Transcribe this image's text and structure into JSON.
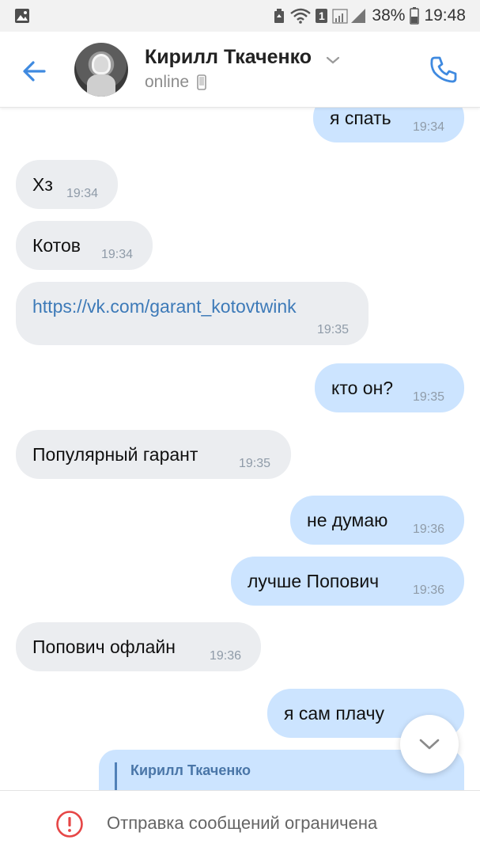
{
  "status_bar": {
    "battery": "38%",
    "time": "19:48",
    "sim_badge": "1"
  },
  "header": {
    "contact_name": "Кирилл Ткаченко",
    "status": "online"
  },
  "messages": [
    {
      "dir": "out",
      "text": "я спать",
      "time": "19:34"
    },
    {
      "dir": "in",
      "text": "Хз",
      "time": "19:34"
    },
    {
      "dir": "in",
      "text": "Котов",
      "time": "19:34"
    },
    {
      "dir": "in",
      "text": "https://vk.com/garant_kotovtwink",
      "time": "19:35",
      "is_link": true
    },
    {
      "dir": "out",
      "text": "кто он?",
      "time": "19:35"
    },
    {
      "dir": "in",
      "text": "Популярный гарант",
      "time": "19:35"
    },
    {
      "dir": "out",
      "text": "не думаю",
      "time": "19:36"
    },
    {
      "dir": "out",
      "text": "лучше Попович",
      "time": "19:36"
    },
    {
      "dir": "in",
      "text": "Попович офлайн",
      "time": "19:36"
    },
    {
      "dir": "out",
      "text": "я сам плачу",
      "time": ""
    }
  ],
  "reply_preview": {
    "author": "Кирилл Ткаченко"
  },
  "footer": {
    "restriction_text": "Отправка сообщений ограничена"
  },
  "colors": {
    "accent": "#3f8ae0",
    "incoming_bubble": "#ebedf0",
    "outgoing_bubble": "#cce4ff",
    "warning": "#e64646"
  },
  "icons": [
    "image-icon",
    "recycle-icon",
    "wifi-icon",
    "signal-icon",
    "battery-icon",
    "back-arrow-icon",
    "chevron-down-icon",
    "phone-icon",
    "mobile-device-icon",
    "alert-icon"
  ]
}
